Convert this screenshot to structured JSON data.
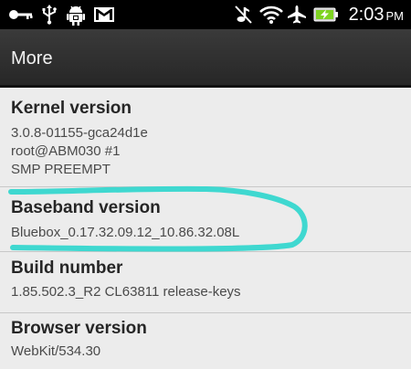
{
  "status_bar": {
    "left_icons": [
      "key-icon",
      "usb-icon",
      "android-debug-icon",
      "gmail-icon"
    ],
    "right_icons": [
      "mute-icon",
      "wifi-icon",
      "airplane-icon",
      "battery-charging-icon"
    ],
    "time": "2:03",
    "ampm": "PM"
  },
  "action_bar": {
    "title": "More"
  },
  "items": [
    {
      "title": "Kernel version",
      "lines": [
        "3.0.8-01155-gca24d1e",
        "root@ABM030 #1",
        "SMP PREEMPT"
      ]
    },
    {
      "title": "Baseband version",
      "lines": [
        "Bluebox_0.17.32.09.12_10.86.32.08L"
      ]
    },
    {
      "title": "Build number",
      "lines": [
        "1.85.502.3_R2 CL63811 release-keys"
      ]
    },
    {
      "title": "Browser version",
      "lines": [
        "WebKit/534.30"
      ]
    }
  ],
  "annotation_color": "#3fd8d0"
}
